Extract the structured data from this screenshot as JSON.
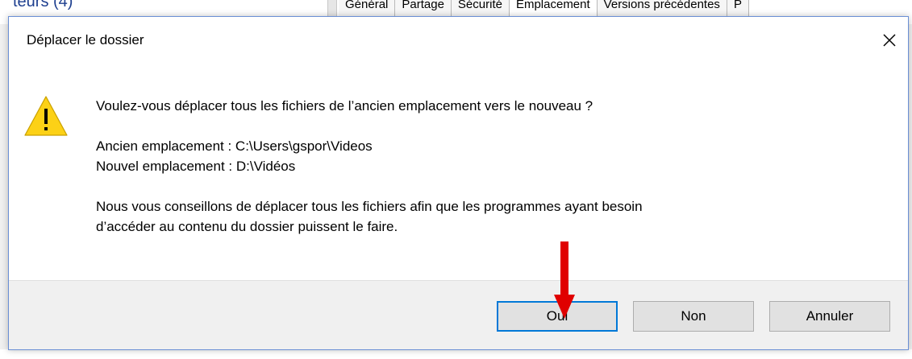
{
  "background": {
    "left_fragment": "teurs (4)",
    "tabs": [
      "Général",
      "Partage",
      "Sécurité",
      "Emplacement",
      "Versions précédentes",
      "P"
    ],
    "active_tab_index": 3
  },
  "dialog": {
    "title": "Déplacer le dossier",
    "close_icon": "close-icon",
    "warning_icon": "warning-icon",
    "question": "Voulez-vous déplacer tous les fichiers de l’ancien emplacement vers le nouveau ?",
    "old_location": "Ancien emplacement : C:\\Users\\gspor\\Videos",
    "new_location": "Nouvel emplacement : D:\\Vidéos",
    "advice_line1": "Nous vous conseillons de déplacer tous les fichiers afin que les programmes ayant besoin",
    "advice_line2": "d’accéder au contenu du dossier puissent le faire.",
    "buttons": {
      "yes": "Oui",
      "no": "Non",
      "cancel": "Annuler"
    }
  },
  "colors": {
    "accent": "#0078d7",
    "warning": "#fcd116",
    "annotation_arrow": "#e00000"
  }
}
